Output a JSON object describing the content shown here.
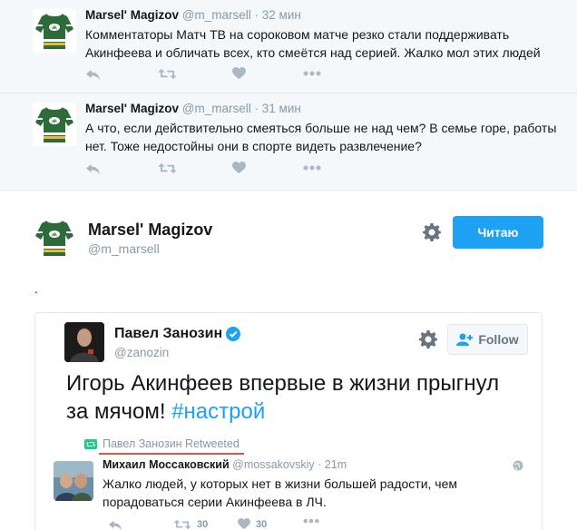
{
  "tweets": [
    {
      "name": "Marsel' Magizov",
      "handle": "@m_marsell",
      "time": "32 мин",
      "text": "Комментаторы Матч ТВ на сороковом матче резко стали поддерживать Акинфеева и обличать всех, кто смеётся над серией. Жалко мол этих людей"
    },
    {
      "name": "Marsel' Magizov",
      "handle": "@m_marsell",
      "time": "31 мин",
      "text": "А что, если действительно смеяться больше не над чем? В семье горе, работы нет. Тоже недостойны они в спорте видеть развлечение?"
    }
  ],
  "separator": "·",
  "profile": {
    "name": "Marsel' Magizov",
    "handle": "@m_marsell",
    "follow_label": "Читаю",
    "status_text": "."
  },
  "embed": {
    "name": "Павел Занозин",
    "handle": "@zanozin",
    "follow_label": "Follow",
    "text_main": "Игорь Акинфеев впервые в жизни прыгнул за мячом! ",
    "hashtag": "#настрой",
    "retweeted_by": "Павел Занозин Retweeted",
    "quoted": {
      "name": "Михаил Моссаковский",
      "handle": "@mossakovskiy",
      "time": "21m",
      "text": "Жалко людей, у которых нет в жизни большей радости, чем порадоваться серии Акинфеева в ЛЧ."
    },
    "retweet_count": "30",
    "like_count": "30"
  },
  "colors": {
    "accent": "#1da1f2",
    "muted": "#8899a6",
    "tweet_bg": "#f5f8fa",
    "jersey_green": "#2e6b3a",
    "underline_red": "#d9534f"
  },
  "icons": [
    "reply-icon",
    "retweet-icon",
    "like-icon",
    "more-icon",
    "gear-icon",
    "verified-icon",
    "add-user-icon",
    "globe-icon"
  ]
}
